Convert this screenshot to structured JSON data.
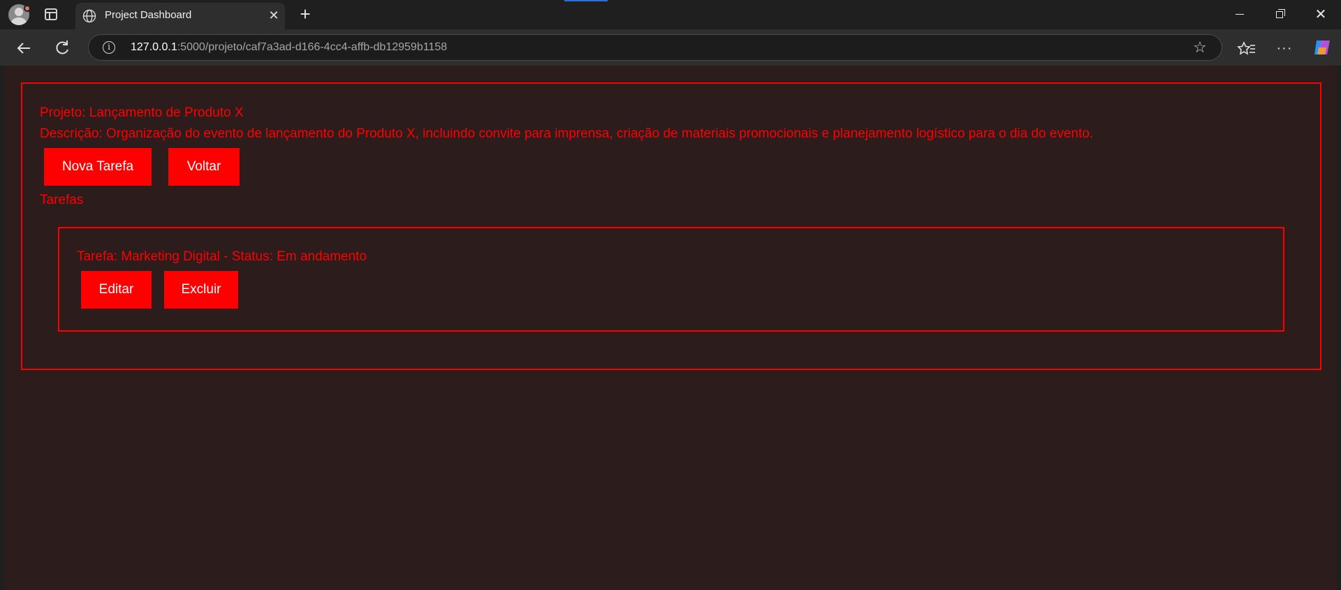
{
  "browser": {
    "tab_title": "Project Dashboard",
    "url_host": "127.0.0.1",
    "url_path": ":5000/projeto/caf7a3ad-d166-4cc4-affb-db12959b1158",
    "icons": [
      "profile-avatar",
      "workspaces-icon",
      "globe-icon",
      "close-icon",
      "plus-icon",
      "back-icon",
      "reload-icon",
      "info-icon",
      "star-icon",
      "favorites-icon",
      "more-icon",
      "copilot-icon"
    ]
  },
  "project": {
    "name_line": "Projeto: Lançamento de Produto X",
    "description_line": "Descrição: Organização do evento de lançamento do Produto X, incluindo convite para imprensa, criação de materiais promocionais e planejamento logístico para o dia do evento.",
    "new_task_label": "Nova Tarefa",
    "back_label": "Voltar",
    "tasks_heading": "Tarefas"
  },
  "tasks": [
    {
      "line": "Tarefa: Marketing Digital - Status: Em andamento",
      "edit_label": "Editar",
      "delete_label": "Excluir"
    }
  ],
  "colors": {
    "accent": "#ff0000",
    "page_background": "#2d1c1c",
    "button_text": "#ffffff"
  }
}
